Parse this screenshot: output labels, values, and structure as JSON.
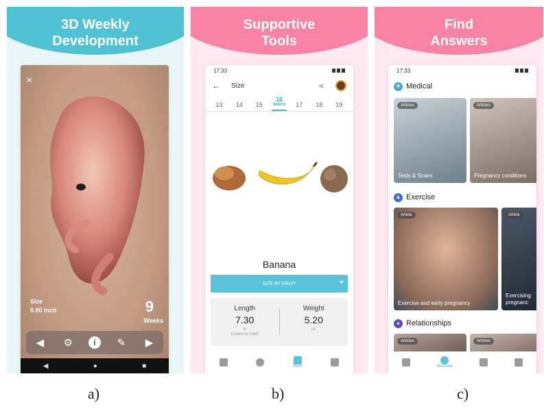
{
  "panel_a": {
    "banner_title": "3D Weekly\nDevelopment",
    "close_glyph": "×",
    "size_label": "Size",
    "size_value": "0.90 inch",
    "week_number": "9",
    "week_unit": "Weeks",
    "caption": "a)"
  },
  "panel_b": {
    "banner_title": "Supportive\nTools",
    "time": "17:33",
    "screen_title": "Size",
    "weeks": [
      {
        "n": "13",
        "sub": ""
      },
      {
        "n": "14",
        "sub": ""
      },
      {
        "n": "15",
        "sub": ""
      },
      {
        "n": "16",
        "sub": "WEEKS"
      },
      {
        "n": "17",
        "sub": ""
      },
      {
        "n": "18",
        "sub": ""
      },
      {
        "n": "19",
        "sub": ""
      }
    ],
    "fruit_name": "Banana",
    "size_button": "SIZE BY FRUIT",
    "length_label": "Length",
    "length_value": "7.30",
    "length_unit": "in",
    "length_note": "(crown to heel)",
    "weight_label": "Weight",
    "weight_value": "5.20",
    "weight_unit": "oz",
    "tab_tools": "Tools",
    "caption": "b)"
  },
  "panel_c": {
    "banner_title": "Find\nAnswers",
    "time": "17:33",
    "sections": {
      "medical": "Medical",
      "exercise": "Exercise",
      "relationships": "Relationships"
    },
    "medical_cards": [
      {
        "badge": "Articles",
        "title": "Tests & Scans"
      },
      {
        "badge": "Articles",
        "title": "Pregnancy conditions"
      }
    ],
    "exercise_cards": [
      {
        "badge": "Article",
        "title": "Exercise and early pregnancy"
      },
      {
        "badge": "Article",
        "title": "Exercising\npregnanc"
      }
    ],
    "relationship_cards": [
      {
        "badge": "Articles"
      },
      {
        "badge": "Articles"
      }
    ],
    "tab_discover": "Discover",
    "caption": "c)"
  },
  "colors": {
    "teal": "#4fc3d3",
    "pink": "#f883a4",
    "accent": "#5bc3dc"
  }
}
